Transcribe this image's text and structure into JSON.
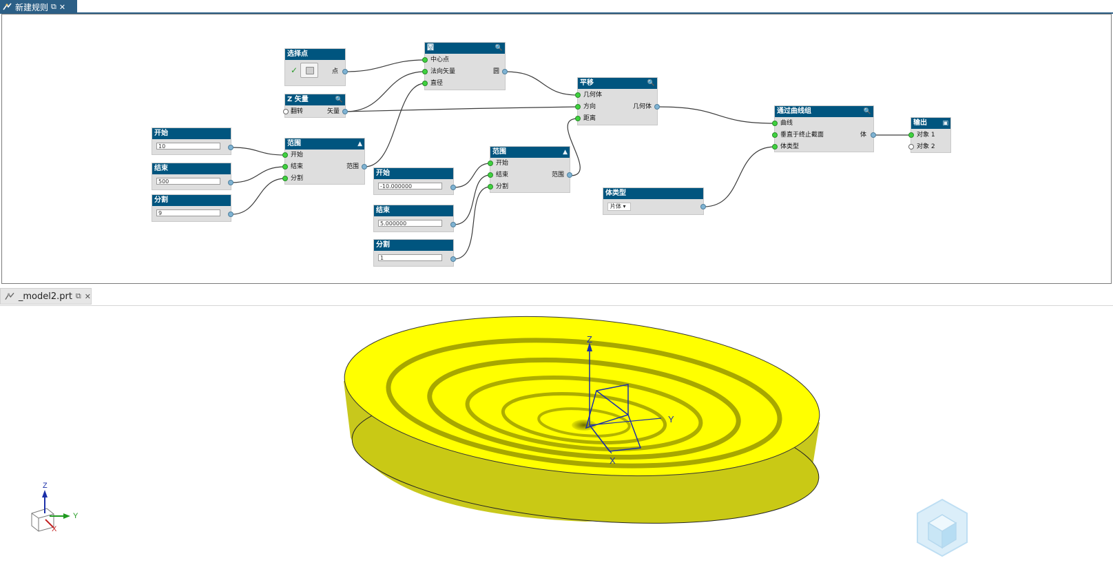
{
  "tabs": {
    "rule_tab": {
      "title": "新建规则",
      "icon": "rule-graph-icon",
      "popout_icon": "popout-icon",
      "close_icon": "close-icon"
    },
    "model_tab": {
      "title": "_model2.prt",
      "icon": "part-file-icon",
      "popout_icon": "popout-icon",
      "close_icon": "close-icon"
    }
  },
  "nodes": {
    "select_point": {
      "title": "选择点",
      "check": "✓",
      "out_label": "点"
    },
    "z_vector": {
      "title": "Z 矢量",
      "in_label": "翻转",
      "out_label": "矢量"
    },
    "start1": {
      "title": "开始",
      "value": "10"
    },
    "end1": {
      "title": "结束",
      "value": "500"
    },
    "div1": {
      "title": "分割",
      "value": "9"
    },
    "range1": {
      "title": "范围",
      "in": [
        "开始",
        "结束",
        "分割"
      ],
      "out_label": "范围"
    },
    "circle": {
      "title": "圆",
      "in": [
        "中心点",
        "法向矢量",
        "直径"
      ],
      "out_label": "圆"
    },
    "start2": {
      "title": "开始",
      "value": "-10.000000"
    },
    "end2": {
      "title": "结束",
      "value": "5.000000"
    },
    "div2": {
      "title": "分割",
      "value": "1"
    },
    "range2": {
      "title": "范围",
      "in": [
        "开始",
        "结束",
        "分割"
      ],
      "out_label": "范围"
    },
    "translate": {
      "title": "平移",
      "in": [
        "几何体",
        "方向",
        "距离"
      ],
      "out_label": "几何体"
    },
    "body_type": {
      "title": "体类型",
      "value": "片体"
    },
    "through_curves": {
      "title": "通过曲线组",
      "in": [
        "曲线",
        "垂直于终止截面",
        "体类型"
      ],
      "out_label": "体"
    },
    "output": {
      "title": "输出",
      "in": [
        "对象 1",
        "对象 2"
      ]
    }
  },
  "viewport": {
    "axis_z": "Z",
    "axis_y": "Y",
    "axis_x": "X",
    "triad_z": "Z",
    "triad_y": "Y",
    "triad_x": "X",
    "surface_color": "#ffff00",
    "triad_icon": "view-triad-icon",
    "navigator_icon": "view-cube-icon"
  }
}
